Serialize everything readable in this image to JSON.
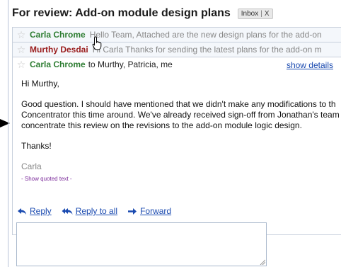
{
  "header": {
    "subject": "For review: Add-on module design plans",
    "label": "Inbox",
    "label_separator": "|",
    "label_remove": "X"
  },
  "messages": [
    {
      "sender": "Carla Chrome",
      "snippet": "Hello Team, Attached are the new design plans for the add-on",
      "color": "#2e7d32"
    },
    {
      "sender": "Murthy Desdai",
      "snippet": "Hi Carla Thanks for sending the latest plans for the add-on m",
      "color": "#9a1c1c"
    }
  ],
  "open_message": {
    "sender": "Carla Chrome",
    "to_line": "to Murthy, Patricia, me",
    "show_details": "show details",
    "greeting": "Hi Murthy,",
    "body_lines": [
      "Good question. I should have mentioned that we didn't make any modifications to th",
      "Concentrator this time around. We've already received sign-off from Jonathan's team",
      "concentrate this review on the revisions to the add-on module logic design."
    ],
    "closing": "Thanks!",
    "signature": "Carla",
    "quoted_toggle": "- Show quoted text -"
  },
  "actions": {
    "reply": "Reply",
    "reply_all": "Reply to all",
    "forward": "Forward"
  },
  "icons": [
    "star-icon",
    "reply-icon",
    "reply-all-icon",
    "forward-icon",
    "hand-cursor-icon",
    "left-arrow-icon"
  ]
}
